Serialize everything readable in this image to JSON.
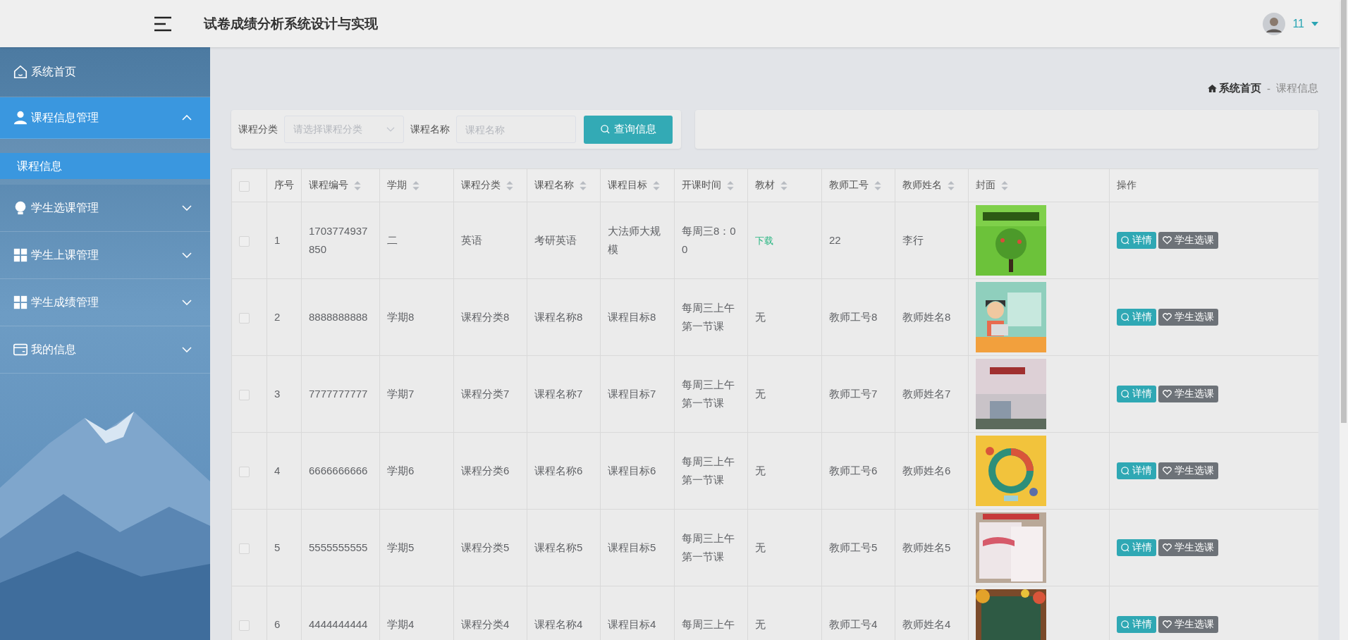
{
  "header": {
    "title": "试卷成绩分析系统设计与实现",
    "user": {
      "name": "11"
    }
  },
  "sidebar": {
    "items": [
      {
        "label": "系统首页",
        "kind": "link",
        "selected": false
      },
      {
        "label": "课程信息管理",
        "kind": "menu",
        "selected": true,
        "expanded": true,
        "children": [
          {
            "label": "课程信息",
            "selected": true
          }
        ]
      },
      {
        "label": "学生选课管理",
        "kind": "menu",
        "selected": false,
        "expanded": false
      },
      {
        "label": "学生上课管理",
        "kind": "menu",
        "selected": false,
        "expanded": false
      },
      {
        "label": "学生成绩管理",
        "kind": "menu",
        "selected": false,
        "expanded": false
      },
      {
        "label": "我的信息",
        "kind": "menu",
        "selected": false,
        "expanded": false
      }
    ]
  },
  "breadcrumb": {
    "items": [
      "系统首页",
      "课程信息"
    ],
    "separator": "-"
  },
  "search": {
    "fields": [
      {
        "label": "课程分类",
        "kind": "select",
        "placeholder": "请选择课程分类"
      },
      {
        "label": "课程名称",
        "kind": "input",
        "placeholder": "课程名称"
      }
    ],
    "button": "查询信息"
  },
  "table": {
    "header_checked": false,
    "columns": [
      {
        "label": "序号",
        "sortable": false
      },
      {
        "label": "课程编号",
        "sortable": true
      },
      {
        "label": "学期",
        "sortable": true
      },
      {
        "label": "课程分类",
        "sortable": true
      },
      {
        "label": "课程名称",
        "sortable": true
      },
      {
        "label": "课程目标",
        "sortable": true
      },
      {
        "label": "开课时间",
        "sortable": true
      },
      {
        "label": "教材",
        "sortable": true
      },
      {
        "label": "教师工号",
        "sortable": true
      },
      {
        "label": "教师姓名",
        "sortable": true
      },
      {
        "label": "封面",
        "sortable": true
      },
      {
        "label": "操作",
        "sortable": false
      }
    ],
    "rows": [
      {
        "checked": false,
        "cells": [
          "1",
          "1703774937850",
          "二",
          "英语",
          "考研英语",
          "大法师大规模",
          "每周三8：00"
        ],
        "textbook": {
          "text": "下载",
          "kind": "link"
        },
        "teacher": [
          "22",
          "李行"
        ],
        "actions": [
          "详情",
          "学生选课"
        ]
      },
      {
        "checked": false,
        "cells": [
          "2",
          "8888888888",
          "学期8",
          "课程分类8",
          "课程名称8",
          "课程目标8",
          "每周三上午第一节课"
        ],
        "textbook": {
          "text": "无",
          "kind": "text"
        },
        "teacher": [
          "教师工号8",
          "教师姓名8"
        ],
        "actions": [
          "详情",
          "学生选课"
        ]
      },
      {
        "checked": false,
        "cells": [
          "3",
          "7777777777",
          "学期7",
          "课程分类7",
          "课程名称7",
          "课程目标7",
          "每周三上午第一节课"
        ],
        "textbook": {
          "text": "无",
          "kind": "text"
        },
        "teacher": [
          "教师工号7",
          "教师姓名7"
        ],
        "actions": [
          "详情",
          "学生选课"
        ]
      },
      {
        "checked": false,
        "cells": [
          "4",
          "6666666666",
          "学期6",
          "课程分类6",
          "课程名称6",
          "课程目标6",
          "每周三上午第一节课"
        ],
        "textbook": {
          "text": "无",
          "kind": "text"
        },
        "teacher": [
          "教师工号6",
          "教师姓名6"
        ],
        "actions": [
          "详情",
          "学生选课"
        ]
      },
      {
        "checked": false,
        "cells": [
          "5",
          "5555555555",
          "学期5",
          "课程分类5",
          "课程名称5",
          "课程目标5",
          "每周三上午第一节课"
        ],
        "textbook": {
          "text": "无",
          "kind": "text"
        },
        "teacher": [
          "教师工号5",
          "教师姓名5"
        ],
        "actions": [
          "详情",
          "学生选课"
        ]
      },
      {
        "checked": false,
        "cells": [
          "6",
          "4444444444",
          "学期4",
          "课程分类4",
          "课程名称4",
          "课程目标4",
          "每周三上午"
        ],
        "textbook": {
          "text": "无",
          "kind": "text"
        },
        "teacher": [
          "教师工号4",
          "教师姓名4"
        ],
        "actions": [
          "详情",
          "学生选课"
        ]
      }
    ]
  }
}
